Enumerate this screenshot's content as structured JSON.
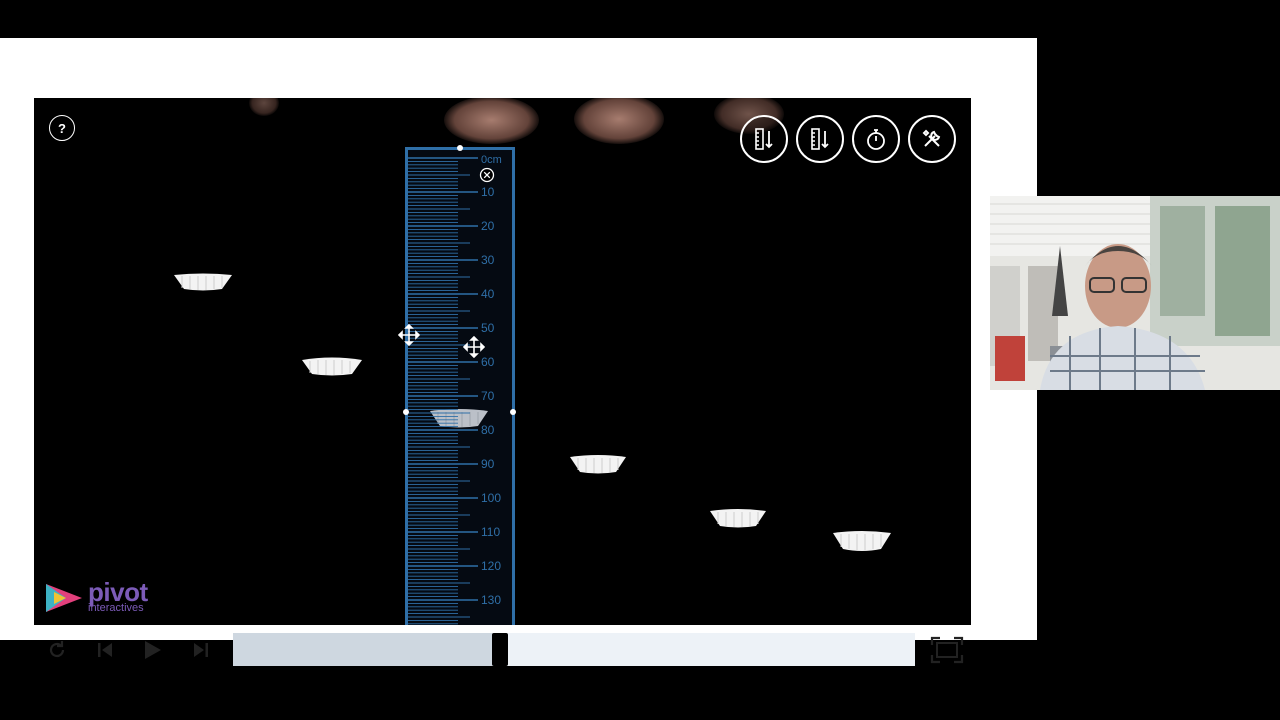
{
  "video": {
    "help_label": "?",
    "tool_buttons": [
      {
        "name": "ruler-tool-1-button",
        "icon": "ruler-arrow-icon"
      },
      {
        "name": "ruler-tool-2-button",
        "icon": "ruler-arrow-icon"
      },
      {
        "name": "stopwatch-button",
        "icon": "stopwatch-icon"
      },
      {
        "name": "settings-tools-button",
        "icon": "wrench-screwdriver-icon"
      }
    ],
    "ruler": {
      "unit_label": "0cm",
      "tick_labels": [
        "10",
        "20",
        "30",
        "40",
        "50",
        "60",
        "70",
        "80",
        "90",
        "100",
        "110",
        "120",
        "130"
      ],
      "color": "#2f6fa7"
    },
    "logo": {
      "word": "pivot",
      "sub": "interactives"
    }
  },
  "controls": {
    "replay_icon": "replay-icon",
    "prev_frame_icon": "step-back-icon",
    "play_icon": "play-icon",
    "next_frame_icon": "step-forward-icon",
    "fullscreen_icon": "fullscreen-icon",
    "progress": 0.39
  },
  "webcam": {
    "icon": "presenter-webcam"
  }
}
